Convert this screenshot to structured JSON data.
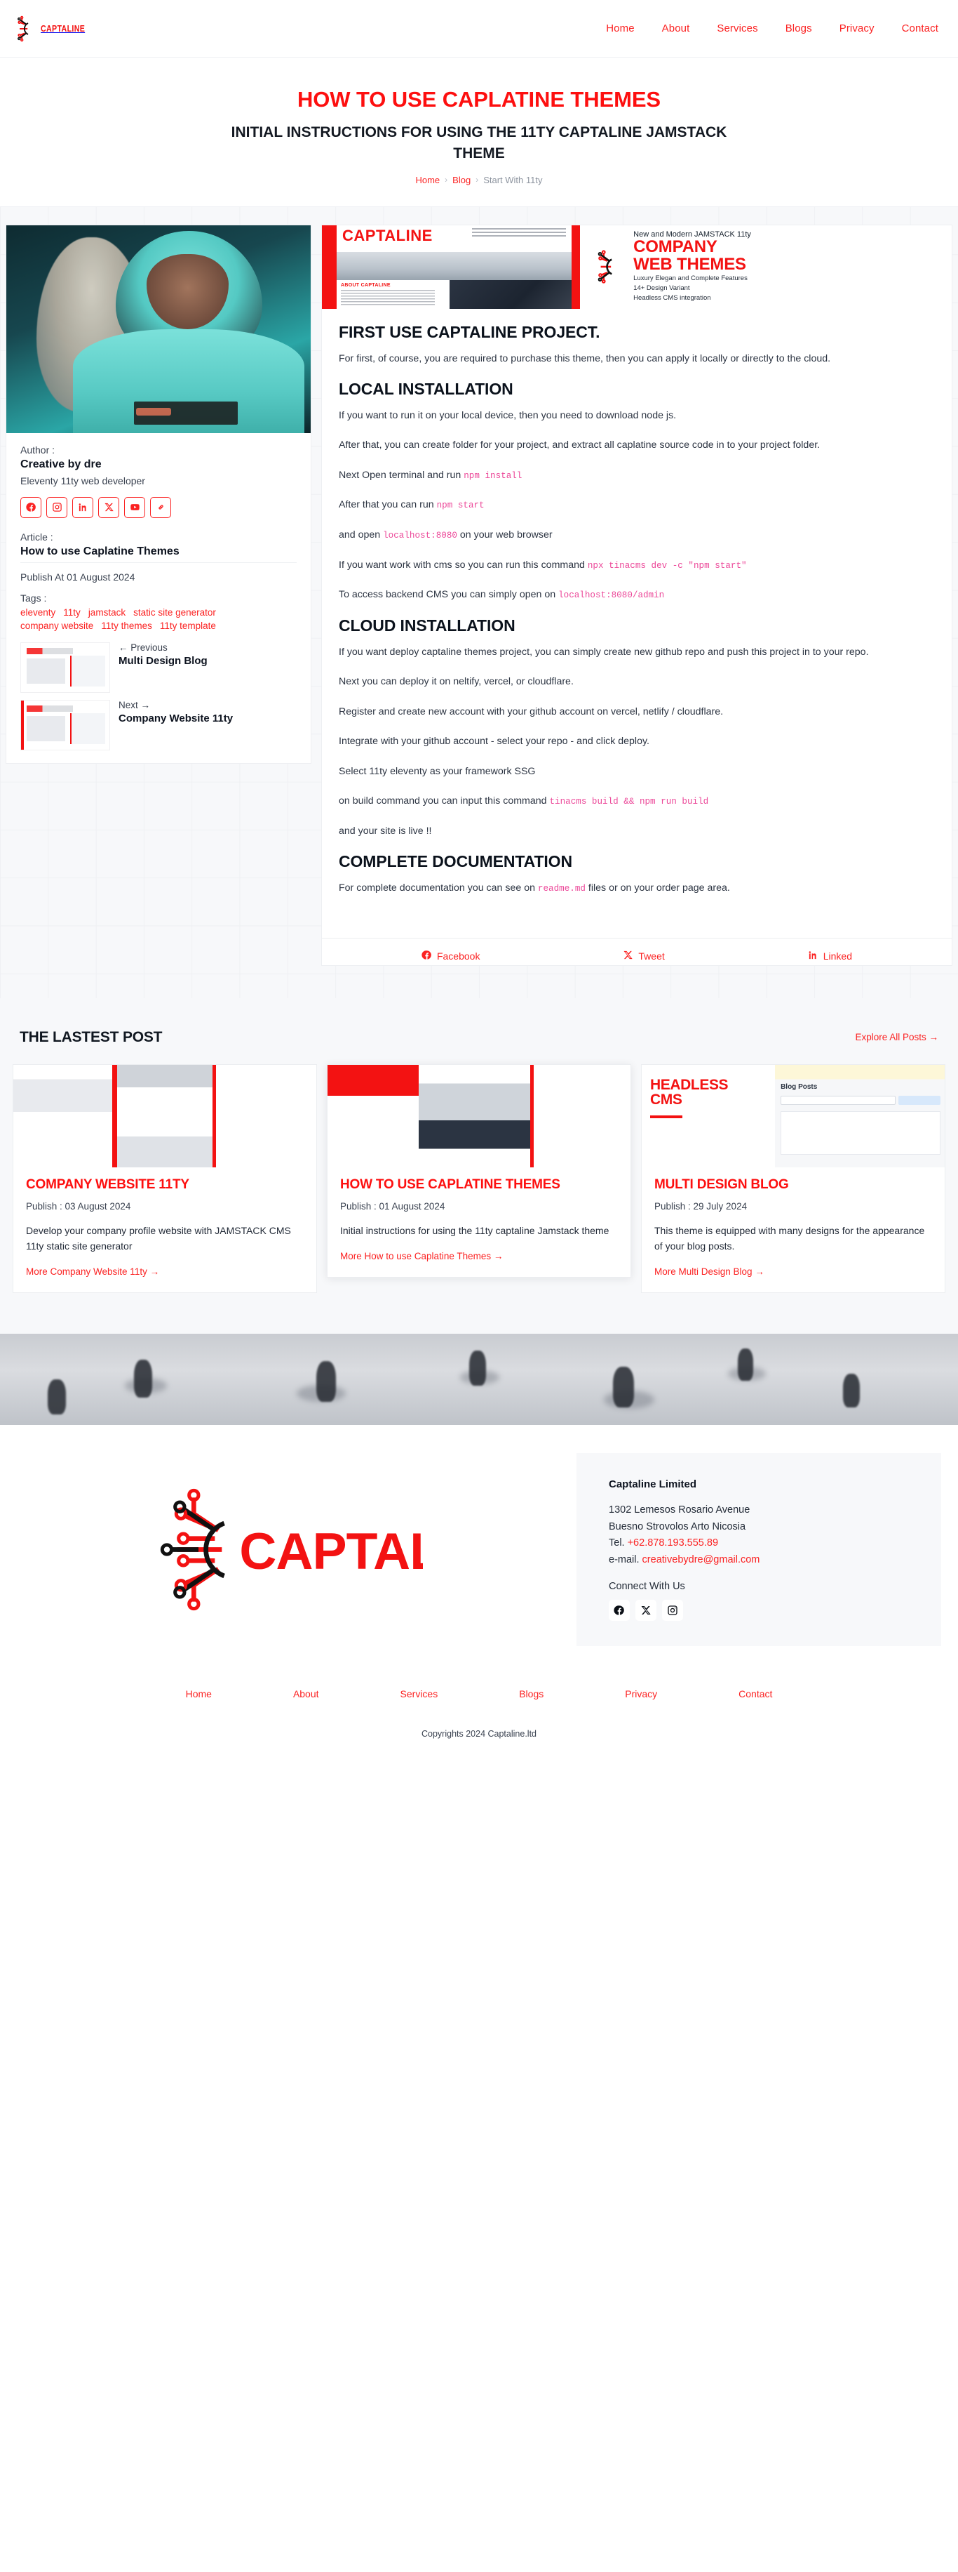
{
  "header": {
    "logo_text": "CAPTALINE",
    "nav": [
      {
        "label": "Home"
      },
      {
        "label": "About"
      },
      {
        "label": "Services"
      },
      {
        "label": "Blogs"
      },
      {
        "label": "Privacy"
      },
      {
        "label": "Contact"
      }
    ]
  },
  "hero": {
    "title": "HOW TO USE CAPLATINE THEMES",
    "subtitle": "INITIAL INSTRUCTIONS FOR USING THE 11TY CAPTALINE JAMSTACK THEME",
    "breadcrumb": {
      "home": "Home",
      "blog": "Blog",
      "current": "Start With 11ty",
      "separator": "›"
    }
  },
  "aside": {
    "author_label": "Author :",
    "author_name": "Creative by dre",
    "author_role": "Eleventy 11ty web developer",
    "socials": [
      {
        "name": "facebook-icon"
      },
      {
        "name": "instagram-icon"
      },
      {
        "name": "linkedin-icon"
      },
      {
        "name": "x-twitter-icon"
      },
      {
        "name": "youtube-icon"
      },
      {
        "name": "link-icon"
      }
    ],
    "article_label": "Article :",
    "article_title": "How to use Caplatine Themes",
    "publish": "Publish At 01 August 2024",
    "tags_label": "Tags :",
    "tags": [
      "eleventy",
      "11ty",
      "jamstack",
      "static site generator",
      "company website",
      "11ty themes",
      "11ty template"
    ],
    "previous": {
      "direction": "← Previous",
      "title": "Multi Design Blog"
    },
    "next": {
      "direction": "Next →",
      "title": "Company Website 11ty"
    }
  },
  "banner": {
    "brand": "CAPTALINE",
    "about_label": "ABOUT CAPTALINE",
    "tagline": "New and Modern JAMSTACK 11ty",
    "headline_1": "COMPANY",
    "headline_2": "WEB THEMES",
    "features": "Luxury Elegan and Complete Features\n14+ Design Variant\nHeadless CMS integration"
  },
  "article": {
    "blocks": [
      {
        "type": "h2",
        "text": "FIRST USE CAPTALINE PROJECT."
      },
      {
        "type": "p",
        "text": "For first, of course, you are required to purchase this theme, then you can apply it locally or directly to the cloud."
      },
      {
        "type": "h2",
        "text": "LOCAL INSTALLATION"
      },
      {
        "type": "p",
        "text": "If you want to run it on your local device, then you need to download node js."
      },
      {
        "type": "p",
        "text": "After that, you can create folder for your project, and extract all caplatine source code in to your project folder."
      },
      {
        "type": "p_code",
        "pre": "Next Open terminal and run ",
        "code": "npm install",
        "post": ""
      },
      {
        "type": "p_code",
        "pre": "After that you can run ",
        "code": "npm start",
        "post": ""
      },
      {
        "type": "p_code",
        "pre": "and open ",
        "code": "localhost:8080",
        "post": " on your web browser"
      },
      {
        "type": "p_code",
        "pre": "If you want work with cms so you can run this command ",
        "code": "npx tinacms dev -c \"npm start\"",
        "post": ""
      },
      {
        "type": "p_code",
        "pre": "To access backend CMS you can simply open on ",
        "code": "localhost:8080/admin",
        "post": ""
      },
      {
        "type": "h2",
        "text": "CLOUD INSTALLATION"
      },
      {
        "type": "p",
        "text": "If you want deploy captaline themes project, you can simply create new github repo and push this project in to your repo."
      },
      {
        "type": "p",
        "text": "Next you can deploy it on neltify, vercel, or cloudflare."
      },
      {
        "type": "p",
        "text": "Register and create new account with your github account on vercel, netlify / cloudflare."
      },
      {
        "type": "p",
        "text": "Integrate with your github account - select your repo - and click deploy."
      },
      {
        "type": "p",
        "text": "Select 11ty eleventy as your framework SSG"
      },
      {
        "type": "p_code",
        "pre": "on build command you can input this command ",
        "code": "tinacms build && npm run build",
        "post": ""
      },
      {
        "type": "p",
        "text": "and your site is live !!"
      },
      {
        "type": "h2",
        "text": "COMPLETE DOCUMENTATION"
      },
      {
        "type": "p_code",
        "pre": "For complete documentation you can see on ",
        "code": "readme.md",
        "post": " files or on your order page area."
      }
    ],
    "share": [
      {
        "icon": "facebook-icon",
        "label": "Facebook"
      },
      {
        "icon": "x-twitter-icon",
        "label": "Tweet"
      },
      {
        "icon": "linkedin-icon",
        "label": "Linked"
      }
    ]
  },
  "latest": {
    "heading": "THE LASTEST POST",
    "explore_label": "Explore All Posts →",
    "cards": [
      {
        "title": "COMPANY WEBSITE 11TY",
        "date": "Publish : 03 August 2024",
        "desc": "Develop your company profile website with JAMSTACK CMS 11ty static site generator",
        "more": "More Company Website 11ty →",
        "thumb_kind": "company"
      },
      {
        "title": "HOW TO USE CAPLATINE THEMES",
        "date": "Publish : 01 August 2024",
        "desc": "Initial instructions for using the 11ty captaline Jamstack theme",
        "more": "More How to use Caplatine Themes →",
        "thumb_kind": "howto"
      },
      {
        "title": "MULTI DESIGN BLOG",
        "date": "Publish : 29 July 2024",
        "desc": "This theme is equipped with many designs for the appearance of your blog posts.",
        "more": "More Multi Design Blog →",
        "thumb_kind": "headless"
      }
    ]
  },
  "footer": {
    "logo_text": "CAPTALINE",
    "company": "Captaline Limited",
    "address_line1": "1302 Lemesos Rosario Avenue",
    "address_line2": "Buesno Strovolos Arto Nicosia",
    "tel_label": "Tel. ",
    "tel_value": "+62.878.193.555.89",
    "email_label": "e-mail. ",
    "email_value": "creativebydre@gmail.com",
    "connect_label": "Connect With Us",
    "socials": [
      {
        "name": "facebook-icon"
      },
      {
        "name": "x-twitter-icon"
      },
      {
        "name": "instagram-icon"
      }
    ],
    "nav": [
      {
        "label": "Home"
      },
      {
        "label": "About"
      },
      {
        "label": "Services"
      },
      {
        "label": "Blogs"
      },
      {
        "label": "Privacy"
      },
      {
        "label": "Contact"
      }
    ],
    "copyright": "Copyrights 2024 Captaline.ltd"
  },
  "colors": {
    "brand_red": "#fb2222",
    "title_red": "#fd0f0f",
    "code_pink": "#ec4899",
    "ink": "#0e1420",
    "bg_gray": "#f7f8fa"
  }
}
